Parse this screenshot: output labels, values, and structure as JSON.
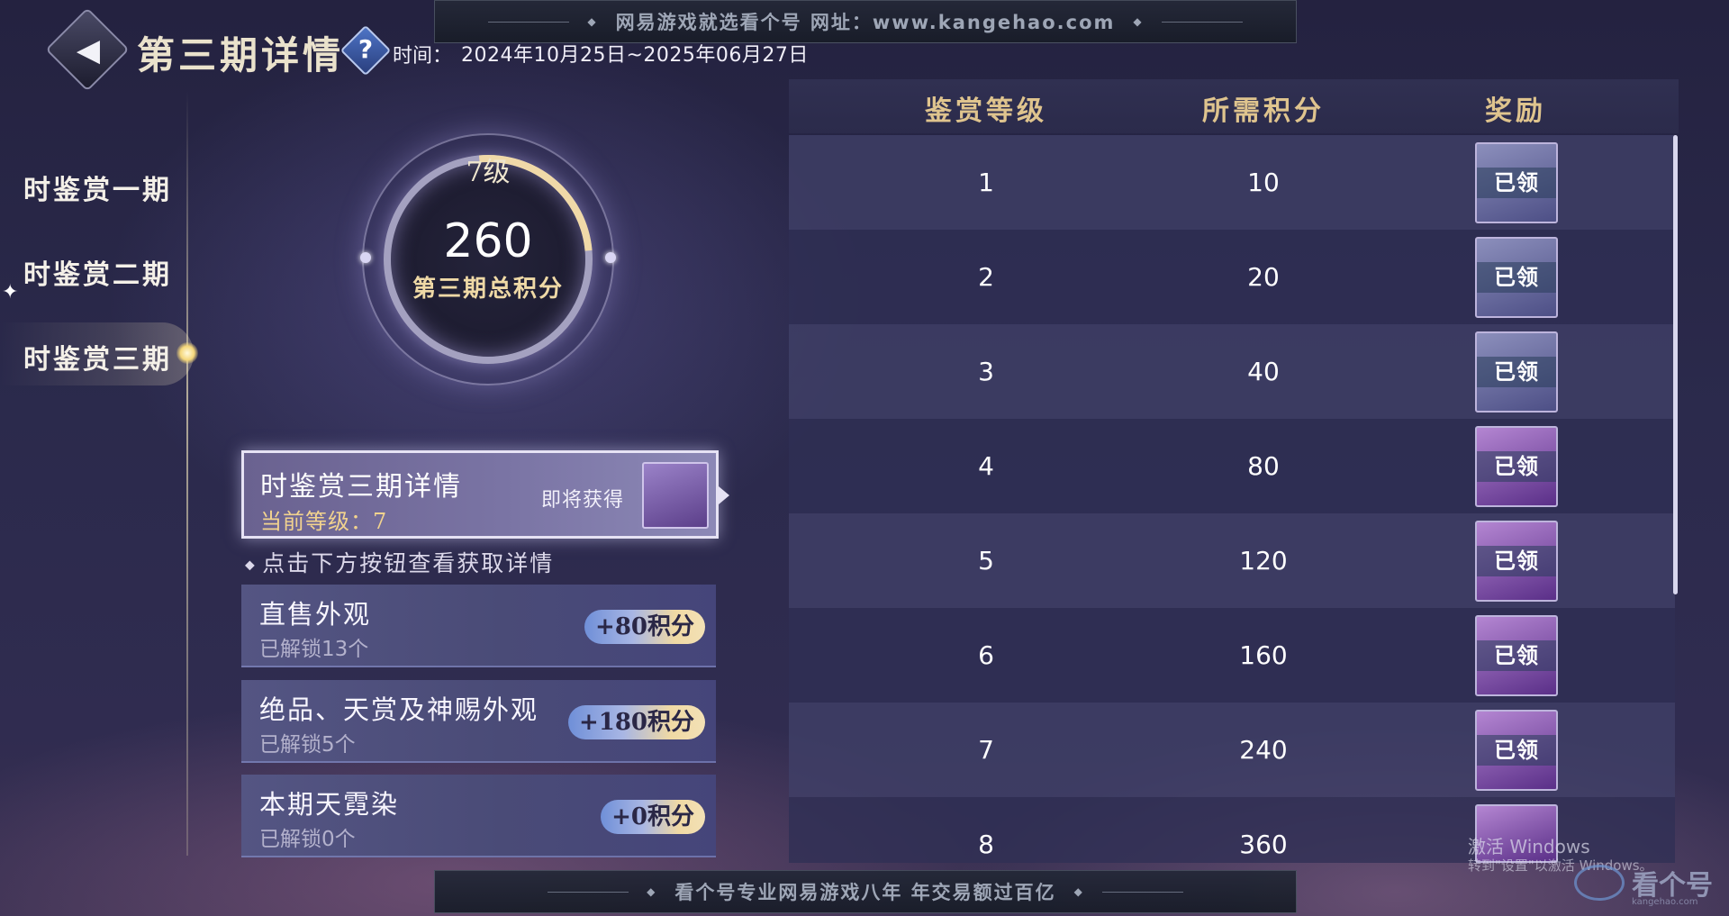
{
  "watermark": {
    "top_text": "网易游戏就选看个号   网址：www.kangehao.com",
    "bottom_text": "看个号专业网易游戏八年   年交易额过百亿"
  },
  "header": {
    "title": "第三期详情",
    "help_symbol": "?",
    "time_label": "时间：",
    "time_range": "2024年10月25日~2025年06月27日"
  },
  "sidebar": {
    "items": [
      {
        "label": "时鉴赏一期"
      },
      {
        "label": "时鉴赏二期"
      },
      {
        "label": "时鉴赏三期"
      }
    ],
    "active_index": 2
  },
  "score": {
    "level": "7级",
    "total": "260",
    "label": "第三期总积分"
  },
  "detail_card": {
    "title": "时鉴赏三期详情",
    "current_level": "当前等级：7",
    "upcoming": "即将获得"
  },
  "hint": "点击下方按钮查看获取详情",
  "sources": [
    {
      "title": "直售外观",
      "unlocked": "已解锁13个",
      "points": "+80积分"
    },
    {
      "title": "绝品、天赏及神赐外观",
      "unlocked": "已解锁5个",
      "points": "+180积分"
    },
    {
      "title": "本期天霓染",
      "unlocked": "已解锁0个",
      "points": "+0积分"
    }
  ],
  "table": {
    "headers": {
      "level": "鉴赏等级",
      "points": "所需积分",
      "reward": "奖励"
    },
    "rows": [
      {
        "level": "1",
        "points": "10",
        "status": "已领"
      },
      {
        "level": "2",
        "points": "20",
        "status": "已领"
      },
      {
        "level": "3",
        "points": "40",
        "status": "已领"
      },
      {
        "level": "4",
        "points": "80",
        "status": "已领"
      },
      {
        "level": "5",
        "points": "120",
        "status": "已领"
      },
      {
        "level": "6",
        "points": "160",
        "status": "已领"
      },
      {
        "level": "7",
        "points": "240",
        "status": "已领"
      },
      {
        "level": "8",
        "points": "360",
        "status": ""
      }
    ]
  },
  "os_overlay": {
    "activate_title": "激活 Windows",
    "activate_sub": "转到\"设置\"以激活 Windows。",
    "brand": "看个号",
    "brand_url": "kangehao.com"
  },
  "colors": {
    "accent_gold": "#dfc48e",
    "points_gold": "#f2d38e",
    "background": "#2b2a4c"
  }
}
